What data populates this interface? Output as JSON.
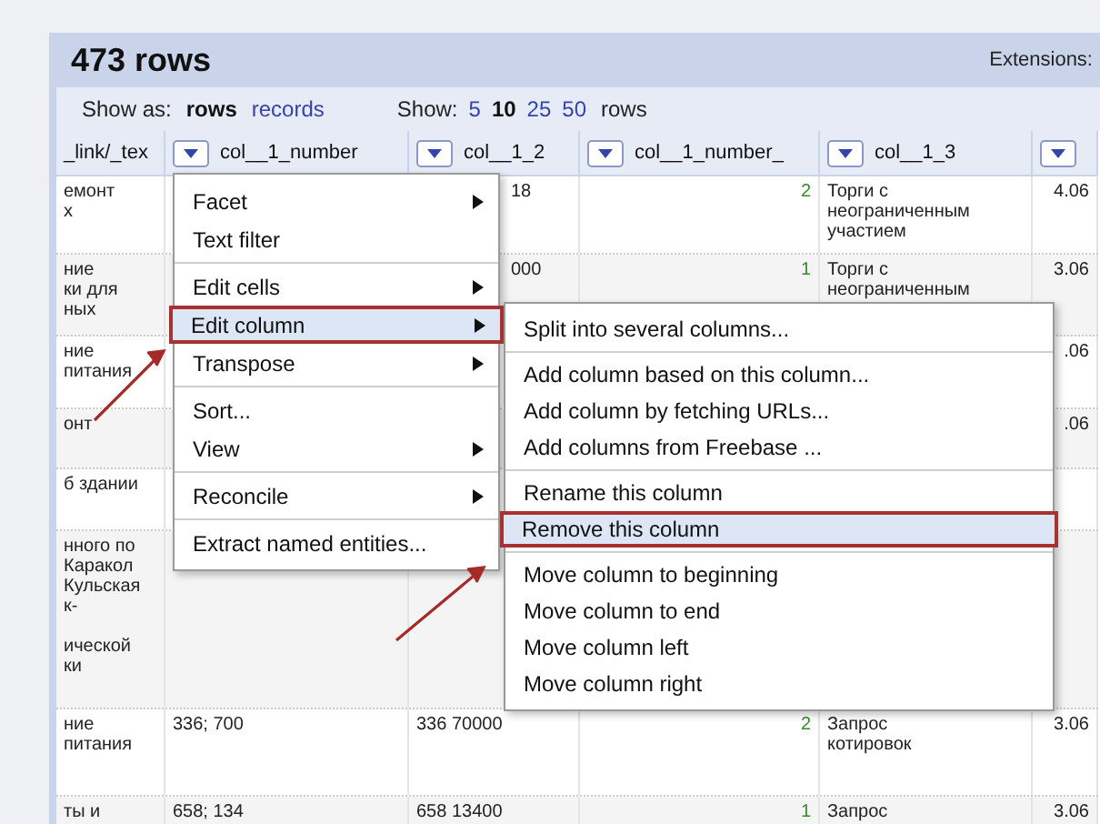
{
  "header": {
    "title": "473 rows",
    "extensions_label": "Extensions:"
  },
  "view_bar": {
    "show_as_label": "Show as:",
    "modes": [
      {
        "label": "rows",
        "selected": true
      },
      {
        "label": "records",
        "selected": false
      }
    ],
    "show_label": "Show:",
    "page_sizes": [
      {
        "label": "5",
        "selected": false
      },
      {
        "label": "10",
        "selected": true
      },
      {
        "label": "25",
        "selected": false
      },
      {
        "label": "50",
        "selected": false
      }
    ],
    "unit": "rows"
  },
  "table": {
    "columns": [
      {
        "label": "_link/_tex",
        "menu_button": false,
        "kind": "text"
      },
      {
        "label": "col__1_number",
        "menu_button": true,
        "kind": "text"
      },
      {
        "label": "col__1_2",
        "menu_button": true,
        "kind": "text"
      },
      {
        "label": "col__1_number_",
        "menu_button": true,
        "kind": "count"
      },
      {
        "label": "col__1_3",
        "menu_button": true,
        "kind": "text"
      },
      {
        "menu_button": true,
        "kind": "text"
      }
    ],
    "rows": [
      [
        "емонт\nх",
        null,
        "18",
        "2",
        "Торги с\nнеограниченным\nучастием",
        "4.06"
      ],
      [
        "ние\nки для\nных",
        null,
        "000",
        "1",
        "Торги с\nнеограниченным",
        "3.06"
      ],
      [
        "ние\nпитания",
        null,
        null,
        null,
        null,
        ".06"
      ],
      [
        "онт",
        null,
        null,
        null,
        null,
        ".06"
      ],
      [
        "б здании",
        null,
        null,
        null,
        null,
        null
      ],
      [
        "нного по\nКаракол\nКульская\nк-\n\nической\nки",
        null,
        null,
        null,
        null,
        null
      ],
      [
        "ние\nпитания",
        "336; 700",
        "336 70000",
        "2",
        "Запрос\nкотировок",
        "3.06"
      ],
      [
        "ты и",
        "658; 134",
        "658 13400",
        "1",
        "Запрос",
        "3.06"
      ]
    ]
  },
  "column_menu": {
    "groups": [
      [
        {
          "label": "Facet",
          "submenu": true,
          "selected": false
        },
        {
          "label": "Text filter",
          "submenu": false,
          "selected": false
        }
      ],
      [
        {
          "label": "Edit cells",
          "submenu": true,
          "selected": false
        },
        {
          "label": "Edit column",
          "submenu": true,
          "selected": true
        },
        {
          "label": "Transpose",
          "submenu": true,
          "selected": false
        }
      ],
      [
        {
          "label": "Sort...",
          "submenu": false,
          "selected": false
        },
        {
          "label": "View",
          "submenu": true,
          "selected": false
        }
      ],
      [
        {
          "label": "Reconcile",
          "submenu": true,
          "selected": false
        }
      ],
      [
        {
          "label": "Extract named entities...",
          "submenu": false,
          "selected": false
        }
      ]
    ]
  },
  "edit_column_submenu": {
    "groups": [
      [
        {
          "label": "Split into several columns...",
          "submenu": false,
          "selected": false
        }
      ],
      [
        {
          "label": "Add column based on this column...",
          "submenu": false,
          "selected": false
        },
        {
          "label": "Add column by fetching URLs...",
          "submenu": false,
          "selected": false
        },
        {
          "label": "Add columns from Freebase ...",
          "submenu": false,
          "selected": false
        }
      ],
      [
        {
          "label": "Rename this column",
          "submenu": false,
          "selected": false
        },
        {
          "label": "Remove this column",
          "submenu": false,
          "selected": true
        }
      ],
      [
        {
          "label": "Move column to beginning",
          "submenu": false,
          "selected": false
        },
        {
          "label": "Move column to end",
          "submenu": false,
          "selected": false
        },
        {
          "label": "Move column left",
          "submenu": false,
          "selected": false
        },
        {
          "label": "Move column right",
          "submenu": false,
          "selected": false
        }
      ]
    ]
  }
}
